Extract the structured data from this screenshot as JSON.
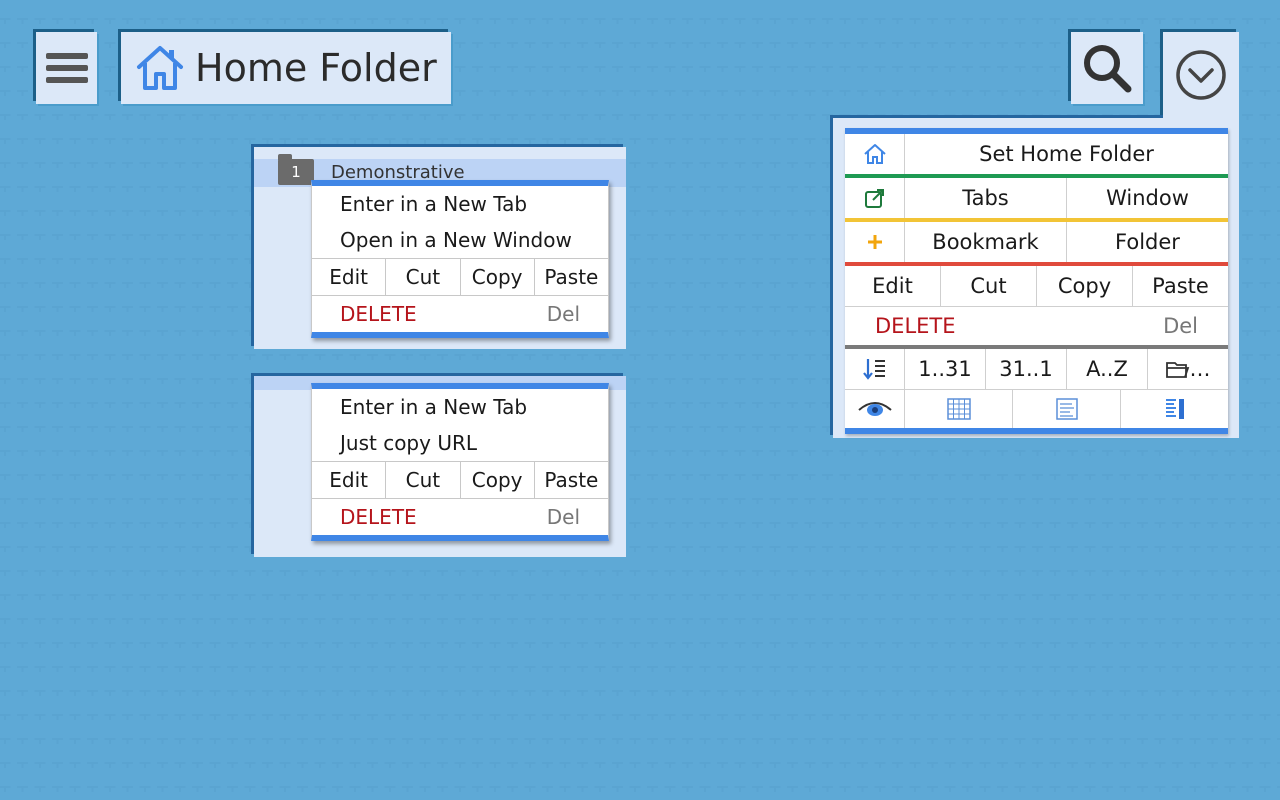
{
  "header": {
    "title": "Home Folder"
  },
  "icons": {
    "menu": "hamburger-icon",
    "home": "home-icon",
    "search": "search-icon",
    "dropdown": "chevron-down-circle-icon"
  },
  "colors": {
    "accent": "#3f86e6",
    "background": "#2e89bf",
    "delete": "#b5141b",
    "green": "#1e9a53",
    "yellow": "#f2c436",
    "red": "#e04a3c"
  },
  "folder_menu": {
    "folder_number": "1",
    "folder_name": "Demonstrative",
    "items": [
      "Enter in a New Tab",
      "Open in a New Window"
    ],
    "actions": [
      "Edit",
      "Cut",
      "Copy",
      "Paste"
    ],
    "delete_label": "DELETE",
    "delete_key": "Del"
  },
  "bookmark_menu": {
    "items": [
      "Enter in a New Tab",
      "Just copy URL"
    ],
    "actions": [
      "Edit",
      "Cut",
      "Copy",
      "Paste"
    ],
    "delete_label": "DELETE",
    "delete_key": "Del"
  },
  "main_menu": {
    "set_home": "Set Home Folder",
    "open_tabs": "Tabs",
    "open_window": "Window",
    "add_bookmark": "Bookmark",
    "add_folder": "Folder",
    "actions": [
      "Edit",
      "Cut",
      "Copy",
      "Paste"
    ],
    "delete_label": "DELETE",
    "delete_key": "Del",
    "sort_options": [
      "1..31",
      "31..1",
      "A..Z",
      "…"
    ]
  }
}
